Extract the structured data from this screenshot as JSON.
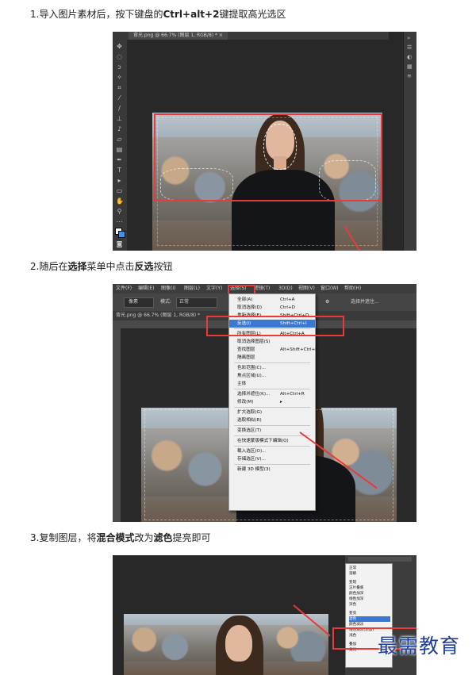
{
  "steps": [
    {
      "number": "1.",
      "parts": [
        "导入图片素材后，按下键盘的",
        "Ctrl+alt+2",
        "键提取高光选区"
      ]
    },
    {
      "number": "2.",
      "parts": [
        "随后在",
        "选择",
        "菜单中点击",
        "反选",
        "按钮"
      ]
    },
    {
      "number": "3.",
      "parts": [
        "复制图层，将",
        "混合模式",
        "改为",
        "滤色",
        "提亮即可"
      ]
    }
  ],
  "shot1": {
    "doc_tab": "背光.png @ 66.7% (图层 1, RGB/8) * ×"
  },
  "shot2": {
    "menubar": [
      "文件(F)",
      "编辑(E)",
      "图像(I)",
      "图层(L)",
      "文字(Y)",
      "选择(S)",
      "滤镜(T)",
      "3D(D)",
      "视图(V)",
      "窗口(W)",
      "帮助(H)"
    ],
    "options": {
      "tool_value": "像素",
      "style_label": "模式:",
      "style_value": "正常",
      "right_label": "选择并遮住..."
    },
    "doc_tab": "背光.png @ 66.7% (图层 1, RGB/8) *",
    "menu_items": [
      {
        "label": "全部(A)",
        "shortcut": "Ctrl+A"
      },
      {
        "label": "取消选择(D)",
        "shortcut": "Ctrl+D"
      },
      {
        "label": "重新选择(E)",
        "shortcut": "Shift+Ctrl+D"
      },
      {
        "label": "反选(I)",
        "shortcut": "Shift+Ctrl+I",
        "highlighted": true
      },
      {
        "sep": true
      },
      {
        "label": "所有图层(L)",
        "shortcut": "Alt+Ctrl+A"
      },
      {
        "label": "取消选择图层(S)",
        "shortcut": ""
      },
      {
        "label": "查找图层",
        "shortcut": "Alt+Shift+Ctrl+F"
      },
      {
        "label": "隔离图层",
        "shortcut": ""
      },
      {
        "sep": true
      },
      {
        "label": "色彩范围(C)...",
        "shortcut": ""
      },
      {
        "label": "焦点区域(U)...",
        "shortcut": ""
      },
      {
        "label": "主体",
        "shortcut": ""
      },
      {
        "sep": true
      },
      {
        "label": "选择并遮住(K)...",
        "shortcut": "Alt+Ctrl+R"
      },
      {
        "label": "修改(M)",
        "shortcut": "▸"
      },
      {
        "sep": true
      },
      {
        "label": "扩大选取(G)",
        "shortcut": ""
      },
      {
        "label": "选取相似(R)",
        "shortcut": ""
      },
      {
        "sep": true
      },
      {
        "label": "变换选区(T)",
        "shortcut": ""
      },
      {
        "sep": true
      },
      {
        "label": "在快速蒙版模式下编辑(Q)",
        "shortcut": ""
      },
      {
        "sep": true
      },
      {
        "label": "载入选区(O)...",
        "shortcut": ""
      },
      {
        "label": "存储选区(V)...",
        "shortcut": ""
      },
      {
        "sep": true
      },
      {
        "label": "新建 3D 模型(3)",
        "shortcut": ""
      }
    ]
  },
  "shot3": {
    "panel_label": "正常",
    "blend_modes": [
      "正常",
      "溶解",
      "",
      "变暗",
      "正片叠底",
      "颜色加深",
      "线性加深",
      "深色",
      "",
      "变亮",
      "滤色",
      "颜色减淡",
      "线性减淡(添加)",
      "浅色",
      "",
      "叠加",
      "柔光"
    ],
    "selected_mode": "滤色"
  },
  "watermark": "最需教育",
  "colors": {
    "accent_red": "#e83a3a",
    "menu_highlight": "#3a78d4",
    "watermark": "#1d3f9a"
  }
}
